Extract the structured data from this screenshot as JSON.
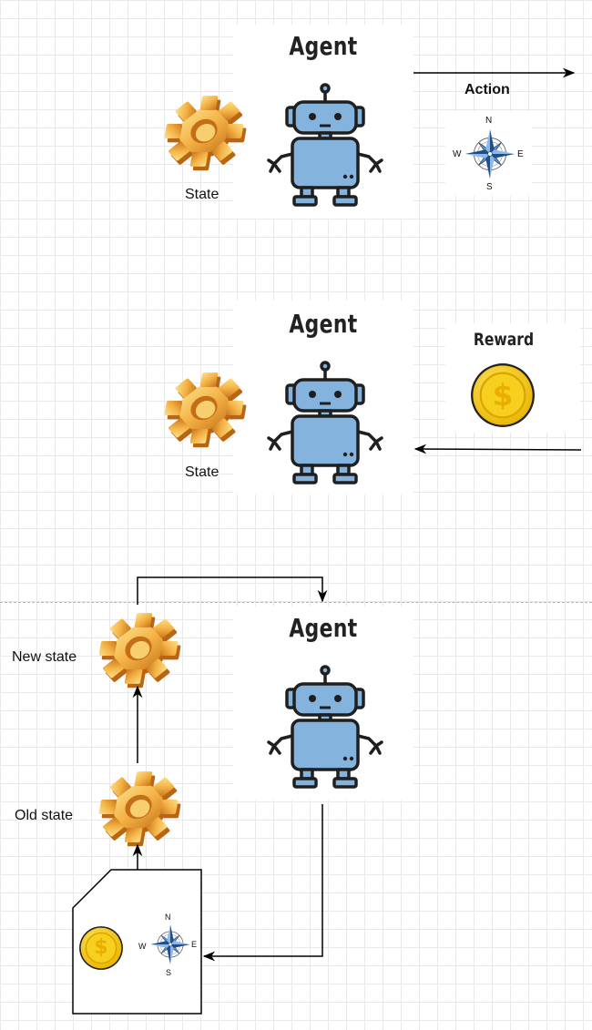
{
  "panel1": {
    "agent_title": "Agent",
    "state_label": "State",
    "action_label": "Action",
    "compass_letters": {
      "n": "N",
      "e": "E",
      "s": "S",
      "w": "W"
    }
  },
  "panel2": {
    "agent_title": "Agent",
    "state_label": "State",
    "reward_title": "Reward",
    "coin_symbol": "$"
  },
  "panel3": {
    "agent_title": "Agent",
    "new_state_label": "New state",
    "old_state_label": "Old state",
    "coin_symbol": "$",
    "compass_letters": {
      "n": "N",
      "e": "E",
      "s": "S",
      "w": "W"
    }
  },
  "colors": {
    "robot_fill": "#84b4dd",
    "robot_stroke": "#1f1f1f",
    "gear_light": "#f7c35a",
    "gear_dark": "#d98a25",
    "coin": "#f3c91a",
    "compass_blue": "#2f6fb0"
  },
  "icons": [
    "gear-icon",
    "robot-icon",
    "compass-icon",
    "coin-icon"
  ]
}
